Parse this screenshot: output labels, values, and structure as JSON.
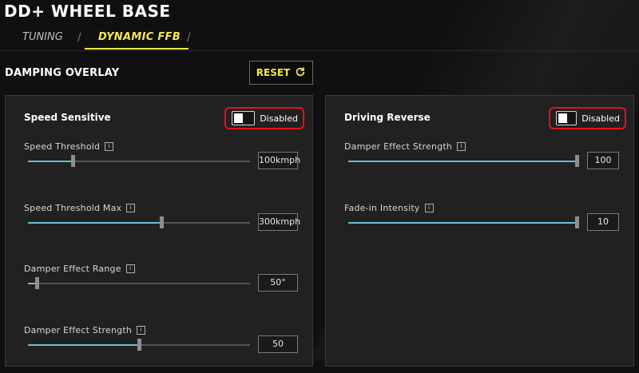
{
  "app": {
    "title": "DD+ WHEEL BASE"
  },
  "tabs": [
    {
      "label": "TUNING",
      "active": false
    },
    {
      "label": "DYNAMIC FFB",
      "active": true
    }
  ],
  "section": {
    "title": "DAMPING OVERLAY",
    "reset_label": "RESET"
  },
  "colors": {
    "accent": "#f2e84b",
    "highlight": "#e8101a",
    "slider_fill": "#6cbccf",
    "panel": "#212121"
  },
  "panels": [
    {
      "title": "Speed Sensitive",
      "toggle": {
        "label": "Disabled",
        "on": false
      },
      "settings": [
        {
          "label": "Speed Threshold",
          "value": "100kmph",
          "fraction": 0.2
        },
        {
          "label": "Speed Threshold Max",
          "value": "300kmph",
          "fraction": 0.6
        },
        {
          "label": "Damper Effect Range",
          "value": "50°",
          "fraction": 0.04
        },
        {
          "label": "Damper Effect Strength",
          "value": "50",
          "fraction": 0.5
        }
      ]
    },
    {
      "title": "Driving Reverse",
      "toggle": {
        "label": "Disabled",
        "on": false
      },
      "settings": [
        {
          "label": "Damper Effect Strength",
          "value": "100",
          "fraction": 1.0
        },
        {
          "label": "Fade-in Intensity",
          "value": "10",
          "fraction": 1.0
        }
      ]
    }
  ],
  "icons": {
    "info": "info-icon",
    "reset": "refresh-icon"
  }
}
